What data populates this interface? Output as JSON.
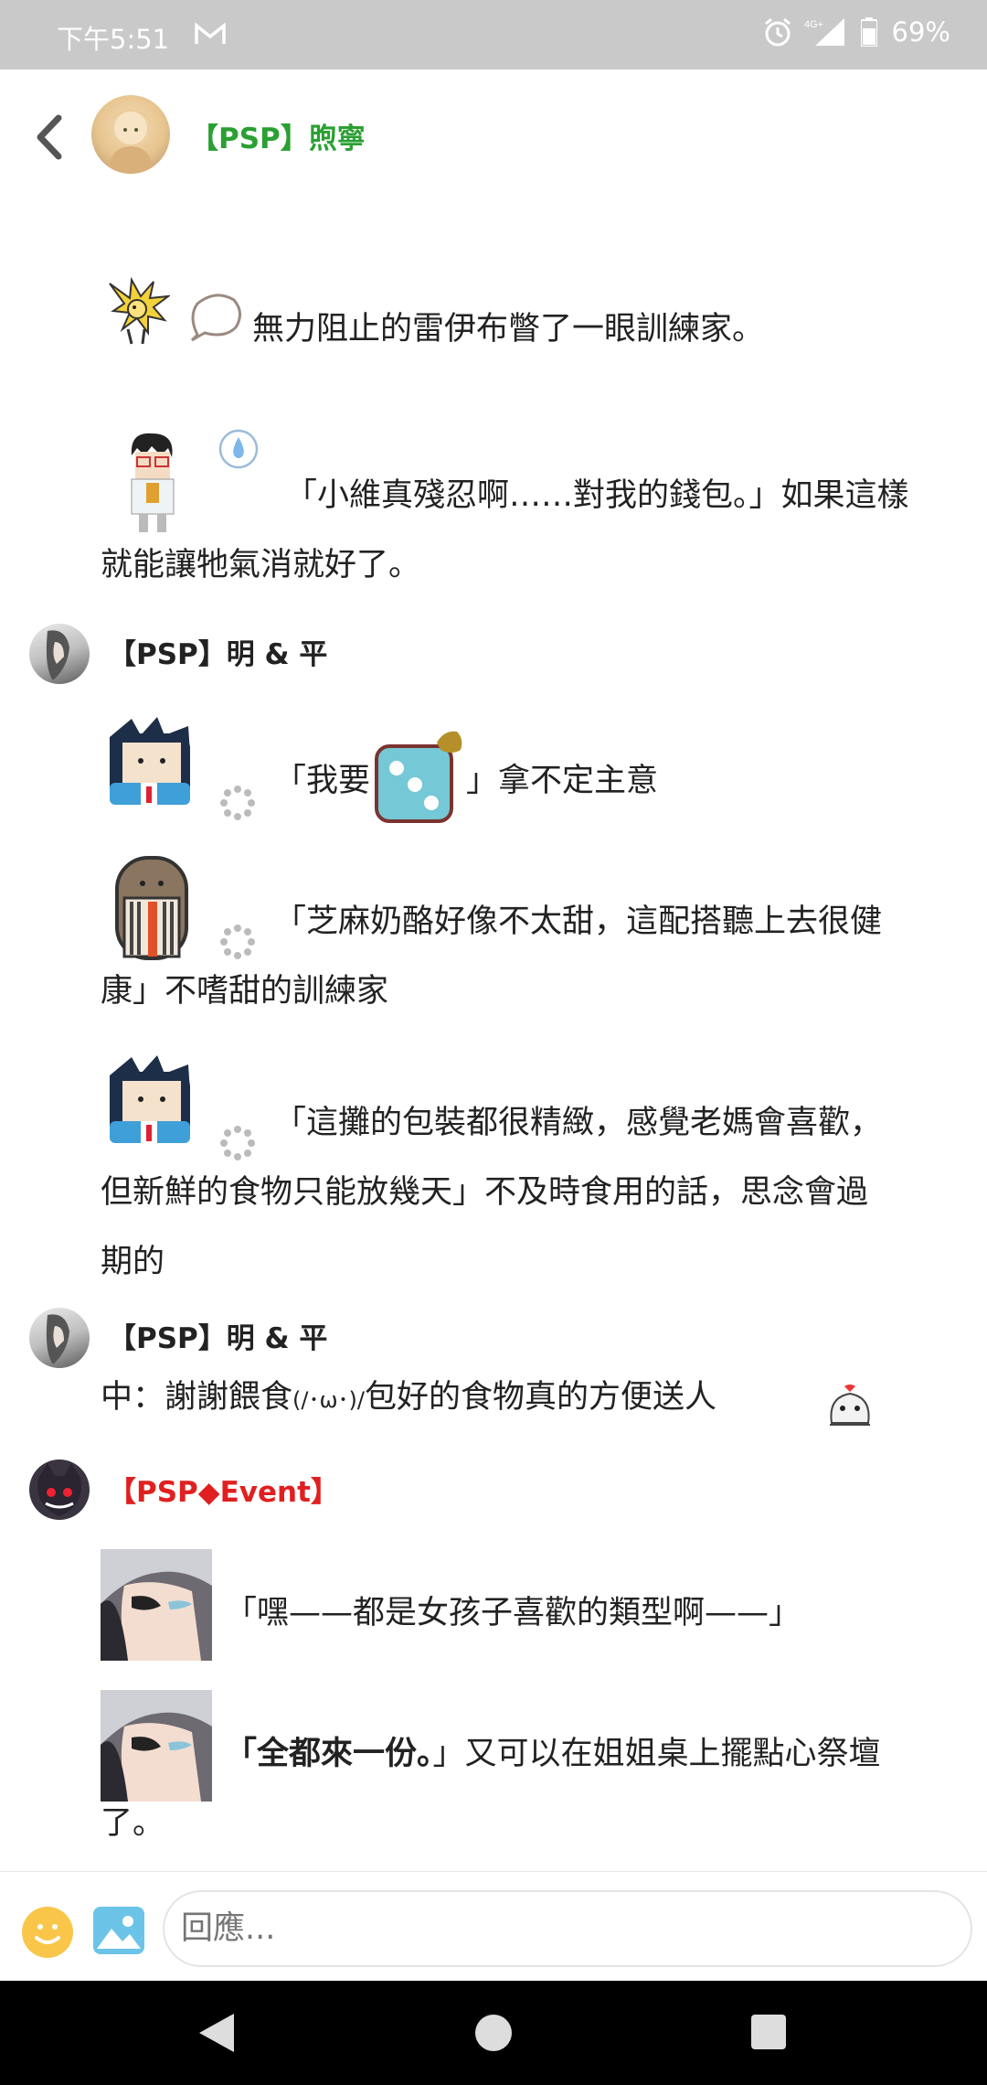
{
  "status_bar": {
    "time": "下午5:51",
    "network": "4G+",
    "battery": "69%"
  },
  "header": {
    "title": "【PSP】煦寧"
  },
  "posts": [
    {
      "text": "無力阻止的雷伊布瞥了一眼訓練家。"
    },
    {
      "text_line1": "「小維真殘忍啊……對我的錢包。」如果這樣",
      "text_line2": "就能讓牠氣消就好了。"
    },
    {
      "user": "【PSP】明 & 平",
      "lines": [
        {
          "before_die": "「我要",
          "after_die": "」拿不定主意"
        },
        {
          "line1": "「芝麻奶酪好像不太甜，這配搭聽上去很健",
          "line2": "康」不嗜甜的訓練家"
        },
        {
          "line1": "「這攤的包裝都很精緻，感覺老媽會喜歡，",
          "line2": "但新鮮的食物只能放幾天」不及時食用的話，思念會過",
          "line3": "期的"
        }
      ]
    },
    {
      "user": "【PSP】明 & 平",
      "text_before_kaomoji": "中：謝謝餵食",
      "kaomoji": "(/･ω･)/",
      "text_after_kaomoji": "包好的食物真的方便送人"
    },
    {
      "user": "【PSP◆Event】",
      "lines": [
        {
          "text": "「嘿——都是女孩子喜歡的類型啊——」"
        },
        {
          "bold": "「全都來一份。",
          "rest": "」又可以在姐姐桌上擺點心祭壇",
          "line2": "了。"
        }
      ]
    }
  ],
  "reply": {
    "placeholder": "回應..."
  },
  "colors": {
    "user_name_green": "#2aa032",
    "event_red": "#e02020",
    "status_bar_bg": "#c9c9c9",
    "nav_bar_bg": "#000000"
  },
  "icons": [
    "back-arrow-icon",
    "mail-icon",
    "alarm-icon",
    "signal-icon",
    "battery-icon",
    "emoji-icon",
    "image-icon",
    "loading-icon"
  ]
}
